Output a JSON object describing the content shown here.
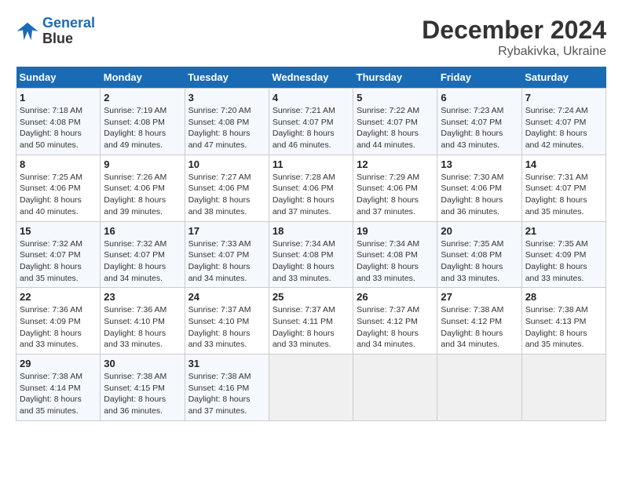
{
  "header": {
    "logo_line1": "General",
    "logo_line2": "Blue",
    "title": "December 2024",
    "subtitle": "Rybakivka, Ukraine"
  },
  "days_of_week": [
    "Sunday",
    "Monday",
    "Tuesday",
    "Wednesday",
    "Thursday",
    "Friday",
    "Saturday"
  ],
  "weeks": [
    [
      {
        "day": "1",
        "sunrise": "7:18 AM",
        "sunset": "4:08 PM",
        "daylight": "8 hours and 50 minutes."
      },
      {
        "day": "2",
        "sunrise": "7:19 AM",
        "sunset": "4:08 PM",
        "daylight": "8 hours and 49 minutes."
      },
      {
        "day": "3",
        "sunrise": "7:20 AM",
        "sunset": "4:08 PM",
        "daylight": "8 hours and 47 minutes."
      },
      {
        "day": "4",
        "sunrise": "7:21 AM",
        "sunset": "4:07 PM",
        "daylight": "8 hours and 46 minutes."
      },
      {
        "day": "5",
        "sunrise": "7:22 AM",
        "sunset": "4:07 PM",
        "daylight": "8 hours and 44 minutes."
      },
      {
        "day": "6",
        "sunrise": "7:23 AM",
        "sunset": "4:07 PM",
        "daylight": "8 hours and 43 minutes."
      },
      {
        "day": "7",
        "sunrise": "7:24 AM",
        "sunset": "4:07 PM",
        "daylight": "8 hours and 42 minutes."
      }
    ],
    [
      {
        "day": "8",
        "sunrise": "7:25 AM",
        "sunset": "4:06 PM",
        "daylight": "8 hours and 40 minutes."
      },
      {
        "day": "9",
        "sunrise": "7:26 AM",
        "sunset": "4:06 PM",
        "daylight": "8 hours and 39 minutes."
      },
      {
        "day": "10",
        "sunrise": "7:27 AM",
        "sunset": "4:06 PM",
        "daylight": "8 hours and 38 minutes."
      },
      {
        "day": "11",
        "sunrise": "7:28 AM",
        "sunset": "4:06 PM",
        "daylight": "8 hours and 37 minutes."
      },
      {
        "day": "12",
        "sunrise": "7:29 AM",
        "sunset": "4:06 PM",
        "daylight": "8 hours and 37 minutes."
      },
      {
        "day": "13",
        "sunrise": "7:30 AM",
        "sunset": "4:06 PM",
        "daylight": "8 hours and 36 minutes."
      },
      {
        "day": "14",
        "sunrise": "7:31 AM",
        "sunset": "4:07 PM",
        "daylight": "8 hours and 35 minutes."
      }
    ],
    [
      {
        "day": "15",
        "sunrise": "7:32 AM",
        "sunset": "4:07 PM",
        "daylight": "8 hours and 35 minutes."
      },
      {
        "day": "16",
        "sunrise": "7:32 AM",
        "sunset": "4:07 PM",
        "daylight": "8 hours and 34 minutes."
      },
      {
        "day": "17",
        "sunrise": "7:33 AM",
        "sunset": "4:07 PM",
        "daylight": "8 hours and 34 minutes."
      },
      {
        "day": "18",
        "sunrise": "7:34 AM",
        "sunset": "4:08 PM",
        "daylight": "8 hours and 33 minutes."
      },
      {
        "day": "19",
        "sunrise": "7:34 AM",
        "sunset": "4:08 PM",
        "daylight": "8 hours and 33 minutes."
      },
      {
        "day": "20",
        "sunrise": "7:35 AM",
        "sunset": "4:08 PM",
        "daylight": "8 hours and 33 minutes."
      },
      {
        "day": "21",
        "sunrise": "7:35 AM",
        "sunset": "4:09 PM",
        "daylight": "8 hours and 33 minutes."
      }
    ],
    [
      {
        "day": "22",
        "sunrise": "7:36 AM",
        "sunset": "4:09 PM",
        "daylight": "8 hours and 33 minutes."
      },
      {
        "day": "23",
        "sunrise": "7:36 AM",
        "sunset": "4:10 PM",
        "daylight": "8 hours and 33 minutes."
      },
      {
        "day": "24",
        "sunrise": "7:37 AM",
        "sunset": "4:10 PM",
        "daylight": "8 hours and 33 minutes."
      },
      {
        "day": "25",
        "sunrise": "7:37 AM",
        "sunset": "4:11 PM",
        "daylight": "8 hours and 33 minutes."
      },
      {
        "day": "26",
        "sunrise": "7:37 AM",
        "sunset": "4:12 PM",
        "daylight": "8 hours and 34 minutes."
      },
      {
        "day": "27",
        "sunrise": "7:38 AM",
        "sunset": "4:12 PM",
        "daylight": "8 hours and 34 minutes."
      },
      {
        "day": "28",
        "sunrise": "7:38 AM",
        "sunset": "4:13 PM",
        "daylight": "8 hours and 35 minutes."
      }
    ],
    [
      {
        "day": "29",
        "sunrise": "7:38 AM",
        "sunset": "4:14 PM",
        "daylight": "8 hours and 35 minutes."
      },
      {
        "day": "30",
        "sunrise": "7:38 AM",
        "sunset": "4:15 PM",
        "daylight": "8 hours and 36 minutes."
      },
      {
        "day": "31",
        "sunrise": "7:38 AM",
        "sunset": "4:16 PM",
        "daylight": "8 hours and 37 minutes."
      },
      null,
      null,
      null,
      null
    ]
  ]
}
